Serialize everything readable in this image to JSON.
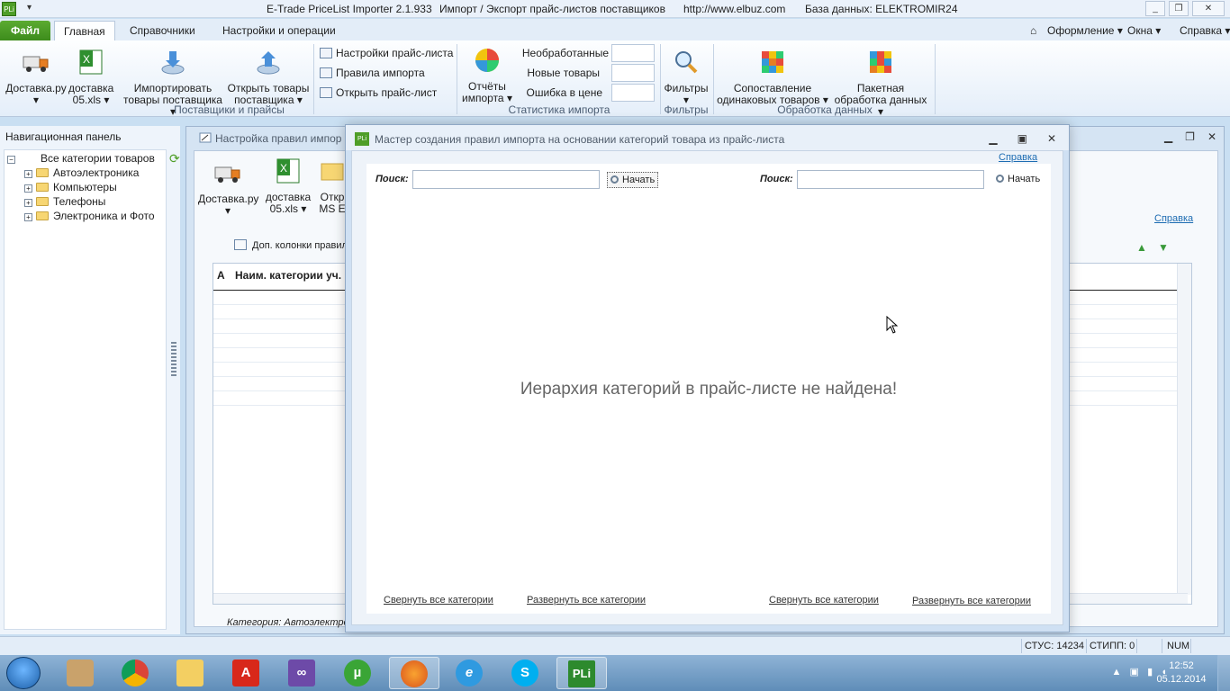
{
  "window": {
    "title_app": "E-Trade PriceList Importer 2.1.933",
    "title_desc": "Импорт / Экспорт прайс-листов поставщиков",
    "title_url": "http://www.elbuz.com",
    "title_db": "База данных: ELEKTROMIR24",
    "logo_text": "PLi"
  },
  "ribbon": {
    "file_tab": "Файл",
    "tabs": [
      "Главная",
      "Справочники",
      "Настройки и операции"
    ],
    "right_menu": {
      "design": "Оформление",
      "windows": "Окна",
      "help": "Справка"
    },
    "buttons": {
      "dostavka": "Доставка.ру",
      "dostavka_xls_1": "доставка",
      "dostavka_xls_2": "05.xls",
      "import_1": "Импортировать",
      "import_2": "товары поставщика",
      "open_1": "Открыть товары",
      "open_2": "поставщика",
      "price_settings": "Настройки прайс-листа",
      "import_rules": "Правила импорта",
      "open_price": "Открыть прайс-лист",
      "reports_1": "Отчёты",
      "reports_2": "импорта",
      "filters": "Фильтры",
      "match_1": "Сопоставление",
      "match_2": "одинаковых товаров",
      "batch_1": "Пакетная",
      "batch_2": "обработка данных"
    },
    "stats": {
      "unprocessed": "Необработанные",
      "new_goods": "Новые товары",
      "price_error": "Ошибка в цене"
    },
    "groups": {
      "suppliers": "Поставщики и прайсы",
      "stats": "Статистика импорта",
      "filters": "Фильтры",
      "processing": "Обработка данных"
    }
  },
  "nav": {
    "header": "Навигационная панель",
    "root": "Все категории товаров",
    "items": [
      "Автоэлектроника",
      "Компьютеры",
      "Телефоны",
      "Электроника и Фото"
    ]
  },
  "bgwin": {
    "title": "Настройка правил импор",
    "tb_dostavka": "Доставка.ру",
    "tb_xls_1": "доставка",
    "tb_xls_2": "05.xls",
    "tb_open_1": "Откр",
    "tb_open_2": "MS E",
    "help": "Справка",
    "extra_cols": "Доп. колонки правил",
    "col_a": "А",
    "col_name": "Наим. категории уч.",
    "footer": "Категория: Автоэлектрон"
  },
  "modal": {
    "title": "Мастер создания правил импорта на основании категорий товара из прайс-листа",
    "help": "Справка",
    "search_label": "Поиск:",
    "start": "Начать",
    "empty_message": "Иерархия категорий в прайс-листе не найдена!",
    "collapse_all": "Свернуть все категории",
    "expand_all": "Развернуть все категории"
  },
  "statusbar": {
    "stus": "СТУС: 14234",
    "stipp": "СТИПП: 0",
    "num": "NUM"
  },
  "taskbar": {
    "time": "12:52",
    "date": "05.12.2014",
    "pli_label": "PLi"
  }
}
